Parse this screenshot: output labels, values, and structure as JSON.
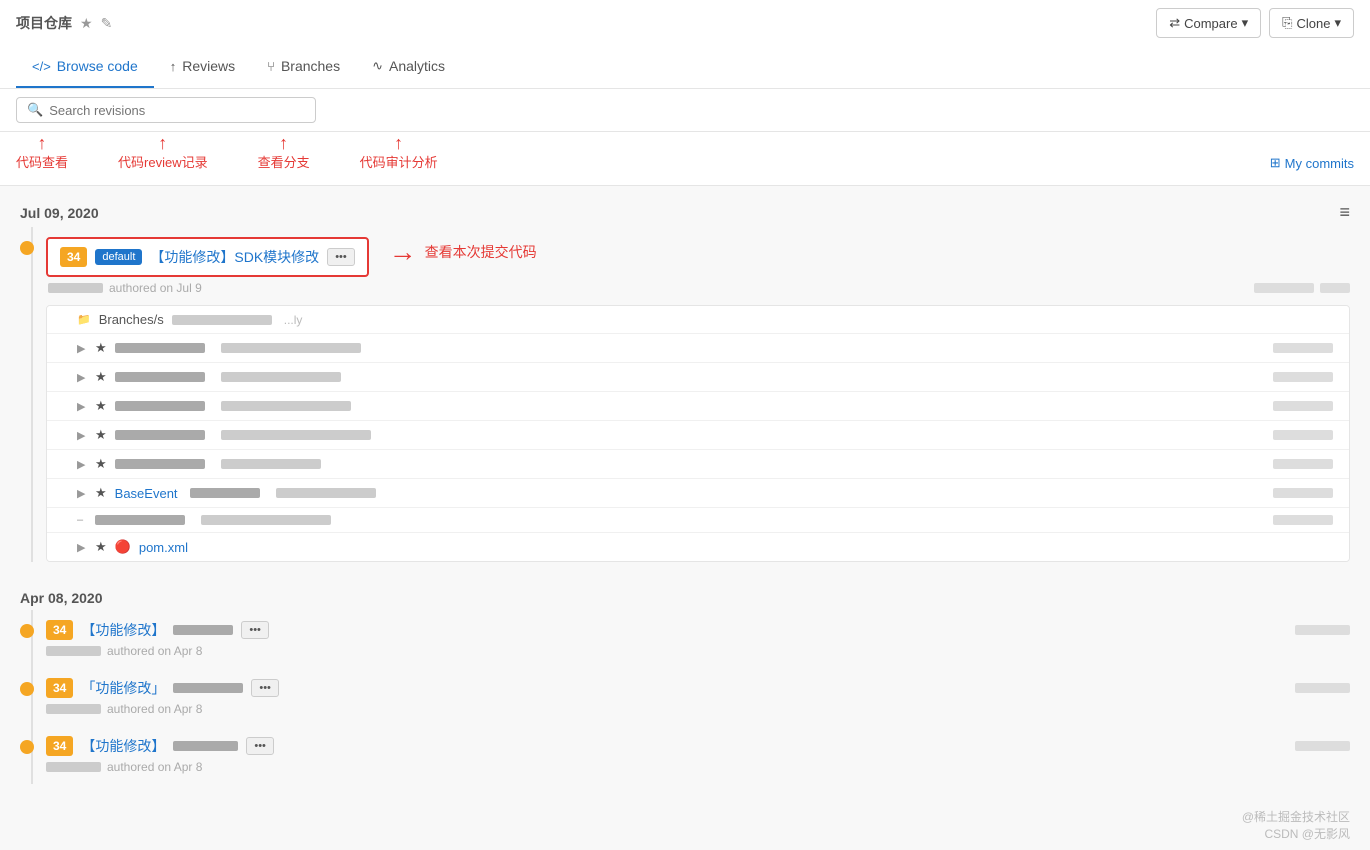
{
  "repo": {
    "name": "项目仓库",
    "star_label": "★",
    "edit_label": "✎"
  },
  "nav": {
    "tabs": [
      {
        "id": "browse-code",
        "label": "Browse code",
        "icon": "</>",
        "active": true
      },
      {
        "id": "reviews",
        "label": "Reviews",
        "icon": "↑"
      },
      {
        "id": "branches",
        "label": "Branches",
        "icon": "⑂"
      },
      {
        "id": "analytics",
        "label": "Analytics",
        "icon": "∿"
      }
    ],
    "compare_label": "Compare",
    "clone_label": "Clone"
  },
  "search": {
    "placeholder": "Search revisions"
  },
  "annotations": [
    {
      "id": "code-view",
      "text": "代码查看"
    },
    {
      "id": "review-history",
      "text": "代码review记录"
    },
    {
      "id": "branches-view",
      "text": "查看分支"
    },
    {
      "id": "analytics-view",
      "text": "代码审计分析"
    }
  ],
  "my_commits": {
    "label": "My commits",
    "icon": "⊞"
  },
  "hamburger_icon": "≡",
  "dates": [
    {
      "id": "date1",
      "label": "Jul 09, 2020",
      "commits": [
        {
          "id": "c1",
          "badge": "34",
          "branch": "default",
          "title": "【功能修改】SDK模块修改",
          "has_dots": true,
          "highlighted": true,
          "sha": "d1f9",
          "author_blur": true,
          "date_text": "authored on Jul 9",
          "right_blur_width": 60
        }
      ],
      "files": [
        {
          "id": "f0",
          "type": "branch",
          "name": "Branches/s",
          "extra_blur": 120,
          "toggle": null,
          "icon": "📁",
          "date_blur": 60
        },
        {
          "id": "f1",
          "type": "file",
          "star": true,
          "name": null,
          "blur1": 100,
          "blur2": 80,
          "date_blur": 80,
          "toggle": "▶"
        },
        {
          "id": "f2",
          "type": "file",
          "star": true,
          "name": null,
          "blur1": 100,
          "blur2": 80,
          "date_blur": 80,
          "toggle": "▶"
        },
        {
          "id": "f3",
          "type": "file",
          "star": true,
          "name": null,
          "blur1": 100,
          "blur2": 80,
          "date_blur": 80,
          "toggle": "▶"
        },
        {
          "id": "f4",
          "type": "file",
          "star": true,
          "name": null,
          "blur1": 100,
          "blur2": 80,
          "date_blur": 80,
          "toggle": "▶"
        },
        {
          "id": "f5",
          "type": "file",
          "star": true,
          "name": null,
          "blur1": 100,
          "blur2": 80,
          "date_blur": 80,
          "toggle": "▶"
        },
        {
          "id": "f6",
          "type": "file",
          "star": true,
          "name": "BaseEvent",
          "blur1": 80,
          "blur2": 60,
          "date_blur": 80,
          "toggle": "▶"
        },
        {
          "id": "f7",
          "type": "file",
          "star": false,
          "name": null,
          "blur1": 100,
          "blur2": 80,
          "date_blur": 80,
          "toggle": "–"
        },
        {
          "id": "f8",
          "type": "pom",
          "name": "pom.xml",
          "blur1": 0,
          "blur2": 0,
          "date_blur": 0,
          "toggle": "▶",
          "star": true
        }
      ]
    },
    {
      "id": "date2",
      "label": "Apr 08, 2020",
      "commits": [
        {
          "id": "c2",
          "badge": "34",
          "branch": null,
          "title": "【功能修改】",
          "has_dots": true,
          "highlighted": false,
          "author_blur": true,
          "date_text": "authored on Apr 8",
          "right_blur_width": 55
        },
        {
          "id": "c3",
          "badge": "34",
          "branch": null,
          "title": "「功能修改」",
          "has_dots": true,
          "highlighted": false,
          "author_blur": true,
          "date_text": "authored on Apr 8",
          "right_blur_width": 55
        },
        {
          "id": "c4",
          "badge": "34",
          "branch": null,
          "title": "【功能修改】",
          "has_dots": true,
          "highlighted": false,
          "author_blur": true,
          "date_text": "authored on Apr 8",
          "right_blur_width": 55
        }
      ]
    }
  ],
  "view_commit_annotation": "查看本次提交代码",
  "watermark_line1": "@稀土掘金技术社区",
  "watermark_line2": "CSDN @无影风",
  "colors": {
    "orange": "#f5a623",
    "red": "#e53935",
    "blue": "#1f75cb",
    "light_gray": "#f0f0f0",
    "mid_gray": "#ccc",
    "border": "#e5e5e5"
  }
}
